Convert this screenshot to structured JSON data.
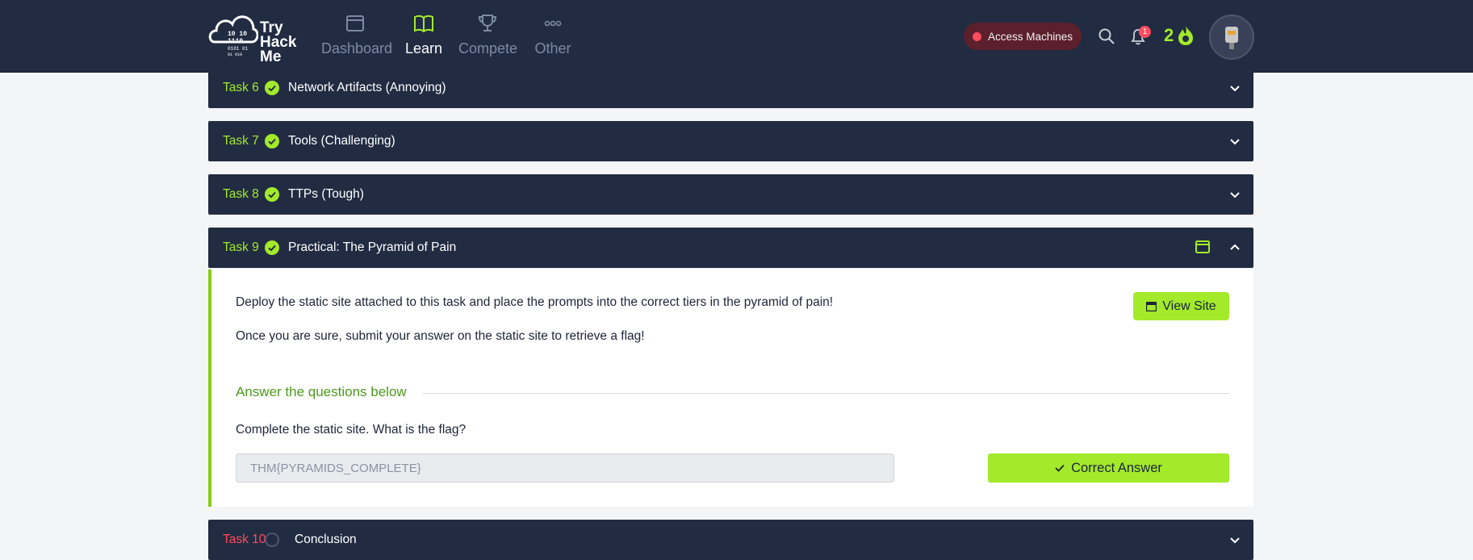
{
  "nav": {
    "logo_text": [
      "Try",
      "Hack",
      "Me"
    ],
    "items": [
      {
        "label": "Dashboard",
        "icon": "dashboard-icon"
      },
      {
        "label": "Learn",
        "icon": "book-icon",
        "active": true
      },
      {
        "label": "Compete",
        "icon": "trophy-icon"
      },
      {
        "label": "Other",
        "icon": "more-icon"
      }
    ],
    "access_machines": "Access Machines",
    "notification_count": "1",
    "streak": "2"
  },
  "tasks": [
    {
      "num": "Task 6",
      "title": "Network Artifacts (Annoying)",
      "completed": true
    },
    {
      "num": "Task 7",
      "title": "Tools (Challenging)",
      "completed": true
    },
    {
      "num": "Task 8",
      "title": "TTPs (Tough)",
      "completed": true
    },
    {
      "num": "Task 9",
      "title": "Practical: The Pyramid of Pain",
      "completed": true,
      "expanded": true
    },
    {
      "num": "Task 10",
      "title": "Conclusion",
      "completed": false
    }
  ],
  "task9_body": {
    "paragraph1": "Deploy the static site attached to this task and place the prompts into the correct tiers in the pyramid of pain!",
    "paragraph2": "Once you are sure, submit your answer on the static site to retrieve a flag!",
    "view_site": "View Site",
    "answer_heading": "Answer the questions below",
    "question": "Complete the static site. What is the flag?",
    "answer_value": "THM{PYRAMIDS_COMPLETE}",
    "answer_button": "Correct Answer"
  },
  "colors": {
    "nav_bg": "#212c42",
    "accent_green": "#a3ea2a",
    "alert_red": "#ff4c5e"
  }
}
